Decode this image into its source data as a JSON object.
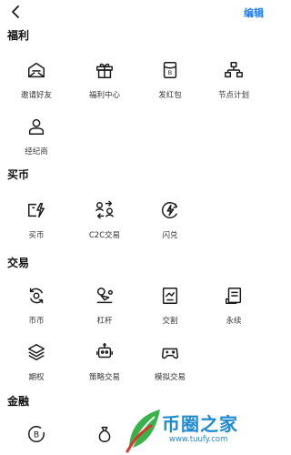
{
  "header": {
    "edit_label": "编辑"
  },
  "sections": [
    {
      "title": "福利",
      "items": [
        {
          "label": "邀请好友",
          "icon": "envelope-icon"
        },
        {
          "label": "福利中心",
          "icon": "gift-icon"
        },
        {
          "label": "发红包",
          "icon": "red-packet-icon"
        },
        {
          "label": "节点计划",
          "icon": "node-tree-icon"
        },
        {
          "label": "经纪商",
          "icon": "person-icon"
        }
      ]
    },
    {
      "title": "买币",
      "items": [
        {
          "label": "买币",
          "icon": "card-lightning-icon"
        },
        {
          "label": "C2C交易",
          "icon": "c2c-icon"
        },
        {
          "label": "闪兑",
          "icon": "flash-swap-icon"
        }
      ]
    },
    {
      "title": "交易",
      "items": [
        {
          "label": "币币",
          "icon": "exchange-icon"
        },
        {
          "label": "杠杆",
          "icon": "leverage-icon"
        },
        {
          "label": "交割",
          "icon": "delivery-chart-icon"
        },
        {
          "label": "永续",
          "icon": "perpetual-icon"
        },
        {
          "label": "期权",
          "icon": "layers-icon"
        },
        {
          "label": "策略交易",
          "icon": "robot-icon"
        },
        {
          "label": "模拟交易",
          "icon": "gamepad-icon"
        }
      ]
    },
    {
      "title": "金融",
      "items": [
        {
          "label": "",
          "icon": "bitcoin-coin-icon"
        },
        {
          "label": "",
          "icon": "money-bag-icon"
        }
      ]
    }
  ],
  "watermark": {
    "text": "币圈之家",
    "url": "www.tuufy.com"
  },
  "colors": {
    "accent": "#1e7ef0",
    "icon": "#1a1a1a",
    "watermark": "#1f8ad0"
  }
}
